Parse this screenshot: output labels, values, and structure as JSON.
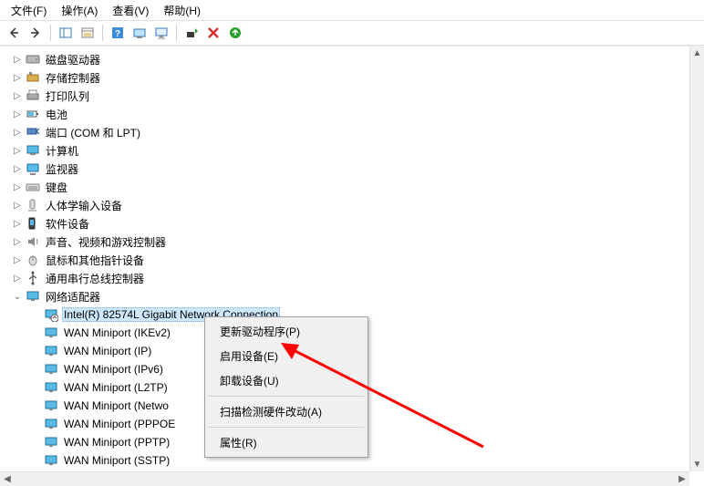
{
  "menubar": {
    "file": "文件(F)",
    "action": "操作(A)",
    "view": "查看(V)",
    "help": "帮助(H)"
  },
  "tree": {
    "disk_drives": "磁盘驱动器",
    "storage_controllers": "存储控制器",
    "print_queues": "打印队列",
    "battery": "电池",
    "ports": "端口 (COM 和 LPT)",
    "computer": "计算机",
    "monitors": "监视器",
    "keyboards": "键盘",
    "hid": "人体学输入设备",
    "software_devices": "软件设备",
    "sound": "声音、视频和游戏控制器",
    "mice": "鼠标和其他指针设备",
    "usb": "通用串行总线控制器",
    "network_adapters": "网络适配器",
    "network_children": {
      "intel": "Intel(R) 82574L Gigabit Network Connection",
      "wan_ikev2": "WAN Miniport (IKEv2)",
      "wan_ip": "WAN Miniport (IP)",
      "wan_ipv6": "WAN Miniport (IPv6)",
      "wan_l2tp": "WAN Miniport (L2TP)",
      "wan_netmonitor": "WAN Miniport (Netwo",
      "wan_pppoe": "WAN Miniport (PPPOE",
      "wan_pptp": "WAN Miniport (PPTP)",
      "wan_sstp": "WAN Miniport (SSTP)"
    }
  },
  "context_menu": {
    "update_driver": "更新驱动程序(P)",
    "enable_device": "启用设备(E)",
    "uninstall_device": "卸载设备(U)",
    "scan_hardware": "扫描检测硬件改动(A)",
    "properties": "属性(R)"
  }
}
